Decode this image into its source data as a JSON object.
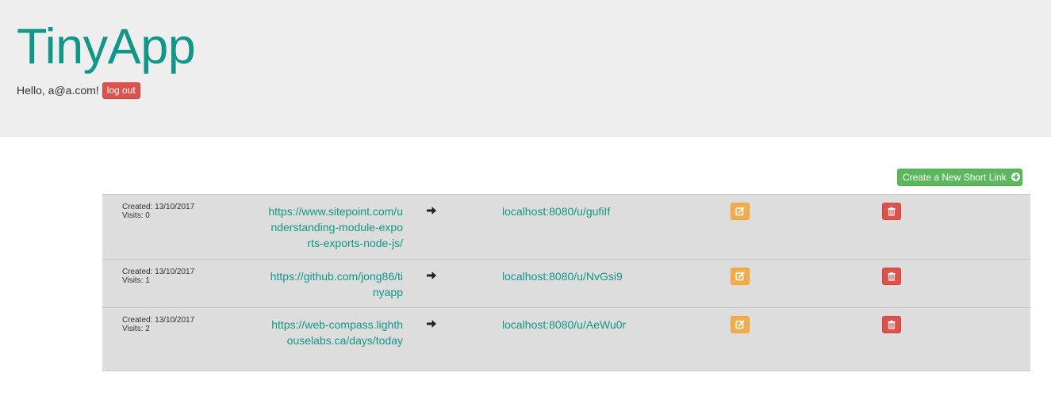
{
  "header": {
    "app_title": "TinyApp",
    "greeting": "Hello, a@a.com!",
    "logout_label": "log out"
  },
  "toolbar": {
    "create_label": "Create a New Short Link",
    "create_icon": "plus-circle-icon"
  },
  "colors": {
    "brand": "#119688",
    "header_bg": "#eeeeee",
    "table_bg": "#dddddd",
    "danger": "#d9534f",
    "warning": "#f0ad4e",
    "success": "#5cb85c"
  },
  "urls": [
    {
      "created": "Created: 13/10/2017",
      "visits": "Visits: 0",
      "long_url": "https://www.sitepoint.com/understanding-module-exports-exports-node-js/",
      "short_url": "localhost:8080/u/gufiIf"
    },
    {
      "created": "Created: 13/10/2017",
      "visits": "Visits: 1",
      "long_url": "https://github.com/jong86/tinyapp",
      "short_url": "localhost:8080/u/NvGsi9"
    },
    {
      "created": "Created: 13/10/2017",
      "visits": "Visits: 2",
      "long_url": "https://web-compass.lighthouselabs.ca/days/today",
      "short_url": "localhost:8080/u/AeWu0r"
    }
  ]
}
